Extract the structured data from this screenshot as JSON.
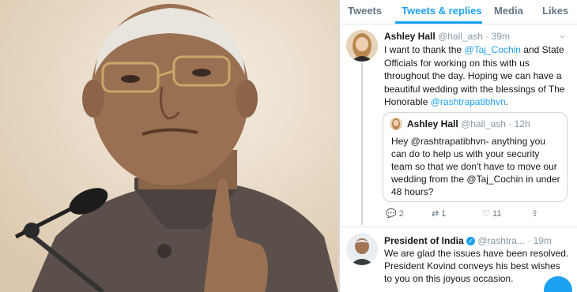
{
  "tabs": [
    {
      "label": "Tweets"
    },
    {
      "label": "Tweets & replies"
    },
    {
      "label": "Media"
    },
    {
      "label": "Likes"
    }
  ],
  "tweet1": {
    "name": "Ashley Hall",
    "handle_time": "@hall_ash · 39m",
    "text_a": "I want to thank the ",
    "mention_a": "@Taj_Cochin",
    "text_b": " and State Officials for working on this with us throughout the day. Hoping we can have a beautiful wedding with the blessings of The Honorable ",
    "mention_b": "@rashtrapatibhvn",
    "text_c": "."
  },
  "quoted": {
    "name": "Ashley Hall",
    "handle_time": "@hall_ash · 12h",
    "text_a": "Hey @rashtrapatibhvn- anything you can do to help us with your security team so that we don't have to move our wedding from the @Taj_Cochin in under 48 hours?"
  },
  "actions": {
    "replies": "2",
    "retweets": "1",
    "likes": "11"
  },
  "tweet2": {
    "name": "President of India",
    "handle_time": "@rashtra... · 19m",
    "text": "We are glad the issues have been resolved. President Kovind conveys his best wishes to you on this joyous occasion."
  },
  "colors": {
    "accent": "#1da1f2",
    "text": "#14171a",
    "muted": "#657786"
  }
}
